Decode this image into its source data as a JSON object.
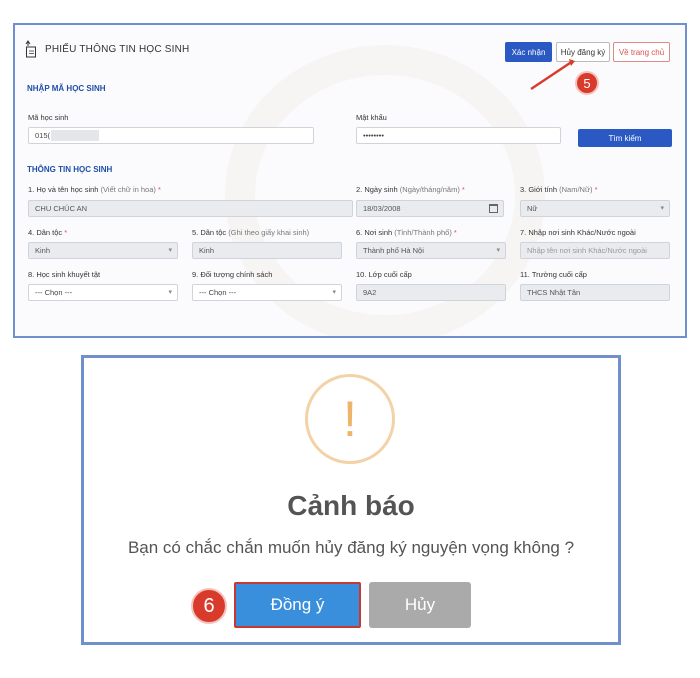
{
  "form": {
    "title": "PHIẾU THÔNG TIN HỌC SINH",
    "buttons": {
      "confirm": "Xác nhận",
      "cancel_registration": "Hủy đăng ký",
      "home": "Về trang chủ",
      "search": "Tìm kiếm"
    },
    "section_lookup": "NHẬP MÃ HỌC SINH",
    "student_id_label": "Mã học sinh",
    "student_id_value": "015(",
    "password_label": "Mật khẩu",
    "password_value": "••••••••",
    "section_info": "THÔNG TIN HỌC SINH",
    "fields": {
      "fullname": {
        "label": "1. Họ và tên học sinh",
        "hint": "(Viết chữ in hoa)",
        "required": "*",
        "value": "CHU CHÚC AN"
      },
      "dob": {
        "label": "2. Ngày sinh",
        "hint": "(Ngày/tháng/năm)",
        "required": "*",
        "value": "18/03/2008"
      },
      "gender": {
        "label": "3. Giới tính",
        "hint": "(Nam/Nữ)",
        "required": "*",
        "value": "Nữ"
      },
      "ethnicity": {
        "label": "4. Dân tộc",
        "required": "*",
        "value": "Kinh"
      },
      "ethnicity_birthcert": {
        "label": "5. Dân tộc",
        "hint": "(Ghi theo giấy khai sinh)",
        "value": "Kinh"
      },
      "birthplace": {
        "label": "6. Nơi sinh",
        "hint": "(Tỉnh/Thành phố)",
        "required": "*",
        "value": "Thành phố Hà Nội"
      },
      "other_birthplace": {
        "label": "7. Nhập nơi sinh Khác/Nước ngoài",
        "placeholder": "Nhập tên nơi sinh Khác/Nước ngoài"
      },
      "disability": {
        "label": "8. Học sinh khuyết tật",
        "value": "--- Chọn ---"
      },
      "policy": {
        "label": "9. Đối tượng chính sách",
        "value": "--- Chọn ---"
      },
      "last_class": {
        "label": "10. Lớp cuối cấp",
        "value": "9A2"
      },
      "last_school": {
        "label": "11. Trường cuối cấp",
        "value": "THCS Nhật Tân"
      }
    }
  },
  "annotations": {
    "step5": "5",
    "step6": "6"
  },
  "dialog": {
    "icon": "exclamation-icon",
    "title": "Cảnh báo",
    "message": "Bạn có chắc chắn muốn hủy đăng ký nguyện vọng không ?",
    "ok_label": "Đồng ý",
    "cancel_label": "Hủy"
  },
  "colors": {
    "primary": "#2b59c3",
    "annotation": "#d83b2c",
    "warning": "#efb36a",
    "dialog_ok": "#3a8fdc"
  }
}
